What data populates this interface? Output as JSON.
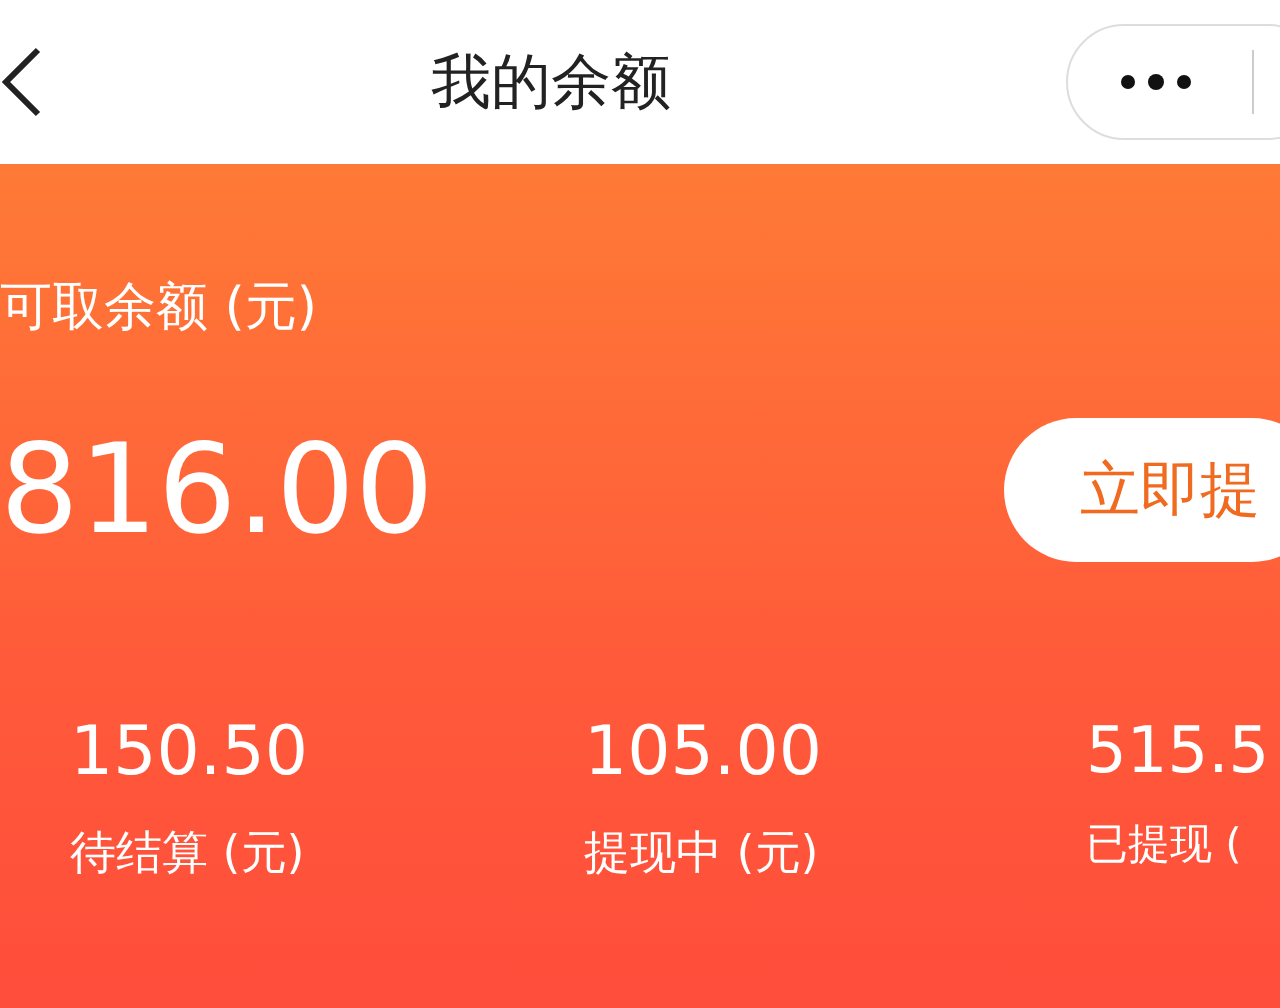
{
  "nav": {
    "title": "我的余额"
  },
  "balance": {
    "label": "可取余额 (元)",
    "amount": "816.00",
    "button": "立即提"
  },
  "stats": [
    {
      "value": "150.50",
      "label": "待结算 (元)"
    },
    {
      "value": "105.00",
      "label": "提现中 (元)"
    },
    {
      "value": "515.5",
      "label": "已提现 ("
    }
  ]
}
